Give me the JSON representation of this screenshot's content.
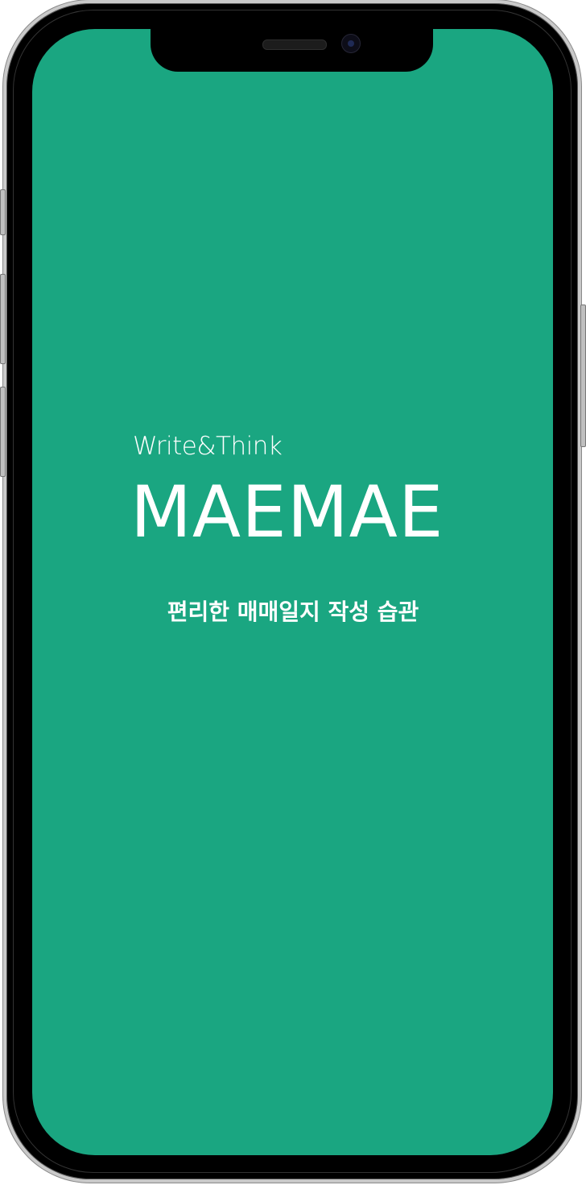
{
  "splash": {
    "tagline": "Write&Think",
    "app_title": "MAEMAE",
    "subtitle": "편리한 매매일지 작성 습관"
  },
  "colors": {
    "background": "#1aa681",
    "text": "#ffffff",
    "device_bezel": "#000000"
  }
}
